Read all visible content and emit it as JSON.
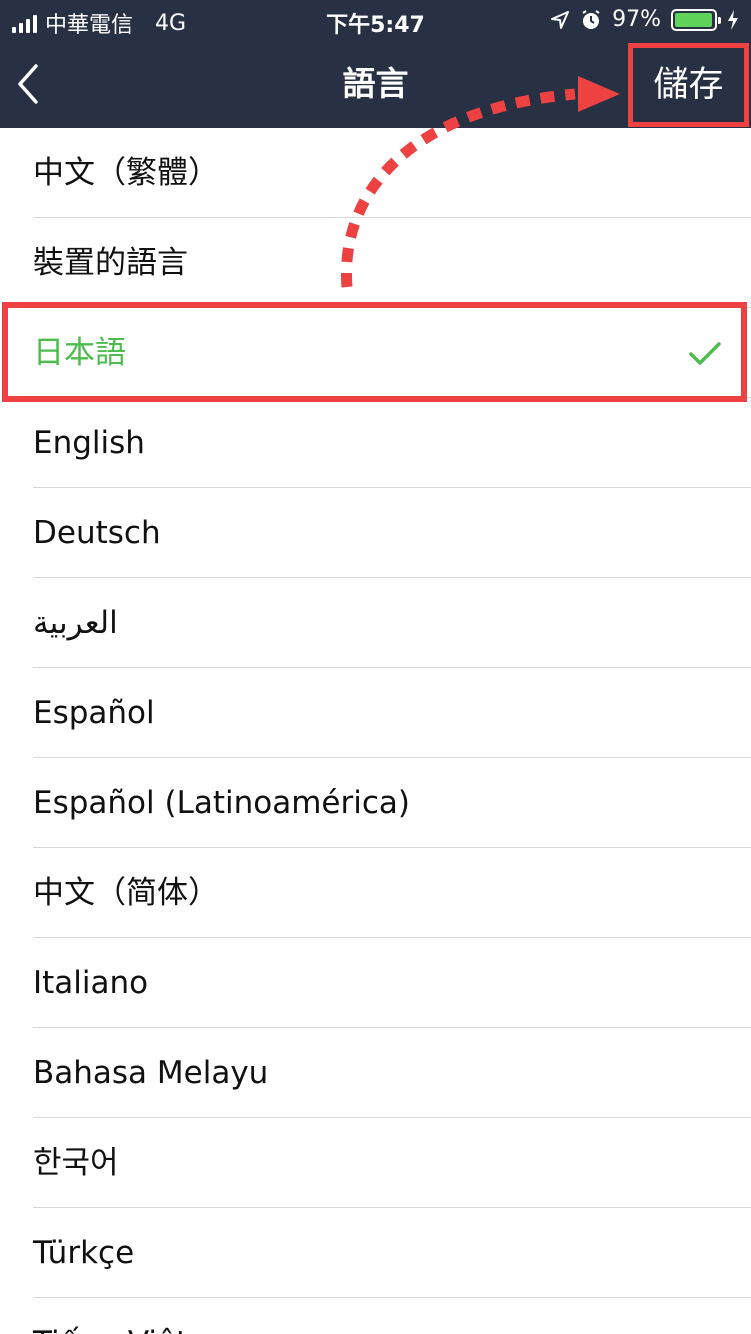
{
  "status_bar": {
    "carrier": "中華電信",
    "network": "4G",
    "time": "下午5:47",
    "battery": "97%",
    "battery_fraction": 0.97
  },
  "nav": {
    "title": "語言",
    "save_label": "儲存",
    "back_icon": "chevron-left-icon"
  },
  "languages": [
    {
      "label": "中文（繁體）",
      "selected": false
    },
    {
      "label": "裝置的語言",
      "selected": false
    },
    {
      "label": "日本語",
      "selected": true
    },
    {
      "label": "English",
      "selected": false
    },
    {
      "label": "Deutsch",
      "selected": false
    },
    {
      "label": "العربية",
      "selected": false
    },
    {
      "label": "Español",
      "selected": false
    },
    {
      "label": "Español (Latinoamérica)",
      "selected": false
    },
    {
      "label": "中文（简体）",
      "selected": false
    },
    {
      "label": "Italiano",
      "selected": false
    },
    {
      "label": "Bahasa Melayu",
      "selected": false
    },
    {
      "label": "한국어",
      "selected": false
    },
    {
      "label": "Türkçe",
      "selected": false
    },
    {
      "label": "Tiếng Việt",
      "selected": false
    }
  ],
  "colors": {
    "header_bg": "#283044",
    "selected_text": "#4cbd4c",
    "annotation_red": "#ee4141",
    "battery_green": "#5fd35a"
  }
}
